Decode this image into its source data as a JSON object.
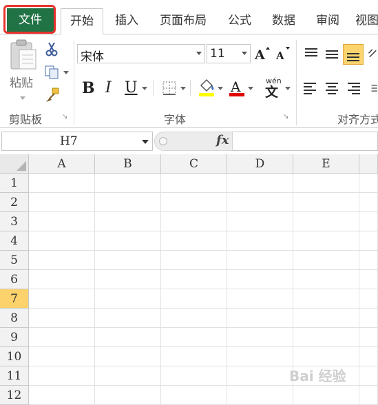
{
  "tabs": {
    "file": "文件",
    "home": "开始",
    "insert": "插入",
    "page_layout": "页面布局",
    "formulas": "公式",
    "data": "数据",
    "review": "审阅",
    "view": "视图"
  },
  "clipboard": {
    "paste_label": "粘贴",
    "group_label": "剪贴板"
  },
  "font": {
    "font_name": "宋体",
    "font_size": "11",
    "bold": "B",
    "italic": "I",
    "underline": "U",
    "font_color_glyph": "A",
    "phonetic_glyph": "wén",
    "group_label": "字体"
  },
  "alignment": {
    "group_label": "对齐方式"
  },
  "formula_bar": {
    "name_box": "H7",
    "fx": "fx",
    "formula": ""
  },
  "grid": {
    "columns": [
      "A",
      "B",
      "C",
      "D",
      "E"
    ],
    "rows": [
      "1",
      "2",
      "3",
      "4",
      "5",
      "6",
      "7",
      "8",
      "9",
      "10",
      "11",
      "12"
    ],
    "selected_row": "7"
  },
  "colors": {
    "file_tab": "#217346",
    "highlight_box": "#e8322d",
    "selected_row_header": "#fbd26b",
    "fill_color": "#ffff00",
    "font_color": "#e00000"
  }
}
